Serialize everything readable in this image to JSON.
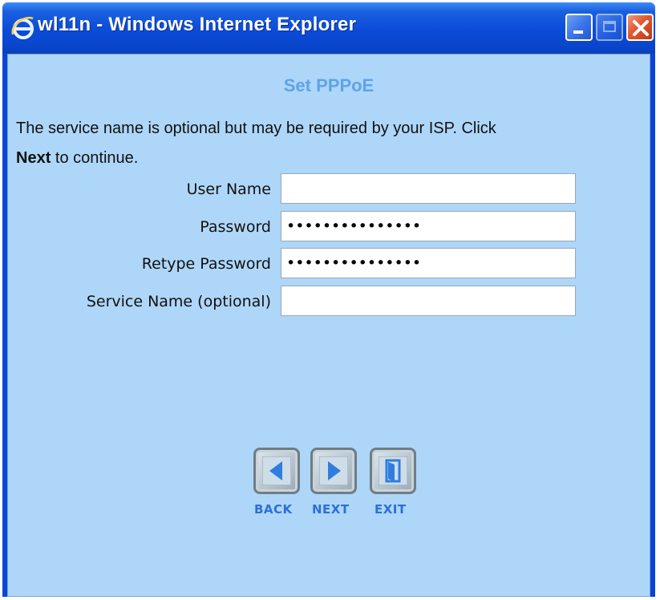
{
  "window": {
    "title": "wl11n - Windows Internet Explorer",
    "icon": "ie-icon",
    "controls": [
      "minimize-icon",
      "maximize-icon",
      "close-icon"
    ]
  },
  "page": {
    "heading": "Set PPPoE",
    "description_part1": "The service name is optional but may be required by your ISP. Click",
    "description_bold": "Next",
    "description_part2": "to continue."
  },
  "form": {
    "user_name_label": "User Name",
    "user_name_value": "",
    "password_label": "Password",
    "password_value": "•••••••••••••••",
    "retype_password_label": "Retype Password",
    "retype_password_value": "•••••••••••••••",
    "service_name_label": "Service Name (optional)",
    "service_name_value": ""
  },
  "nav": {
    "back_label": "BACK",
    "next_label": "NEXT",
    "exit_label": "EXIT"
  },
  "colors": {
    "titlebar": "#0a46cc",
    "content_bg": "#aed6f8",
    "heading": "#5fa3e8",
    "nav_label": "#2e6fd6",
    "arrow": "#2f7de0"
  }
}
